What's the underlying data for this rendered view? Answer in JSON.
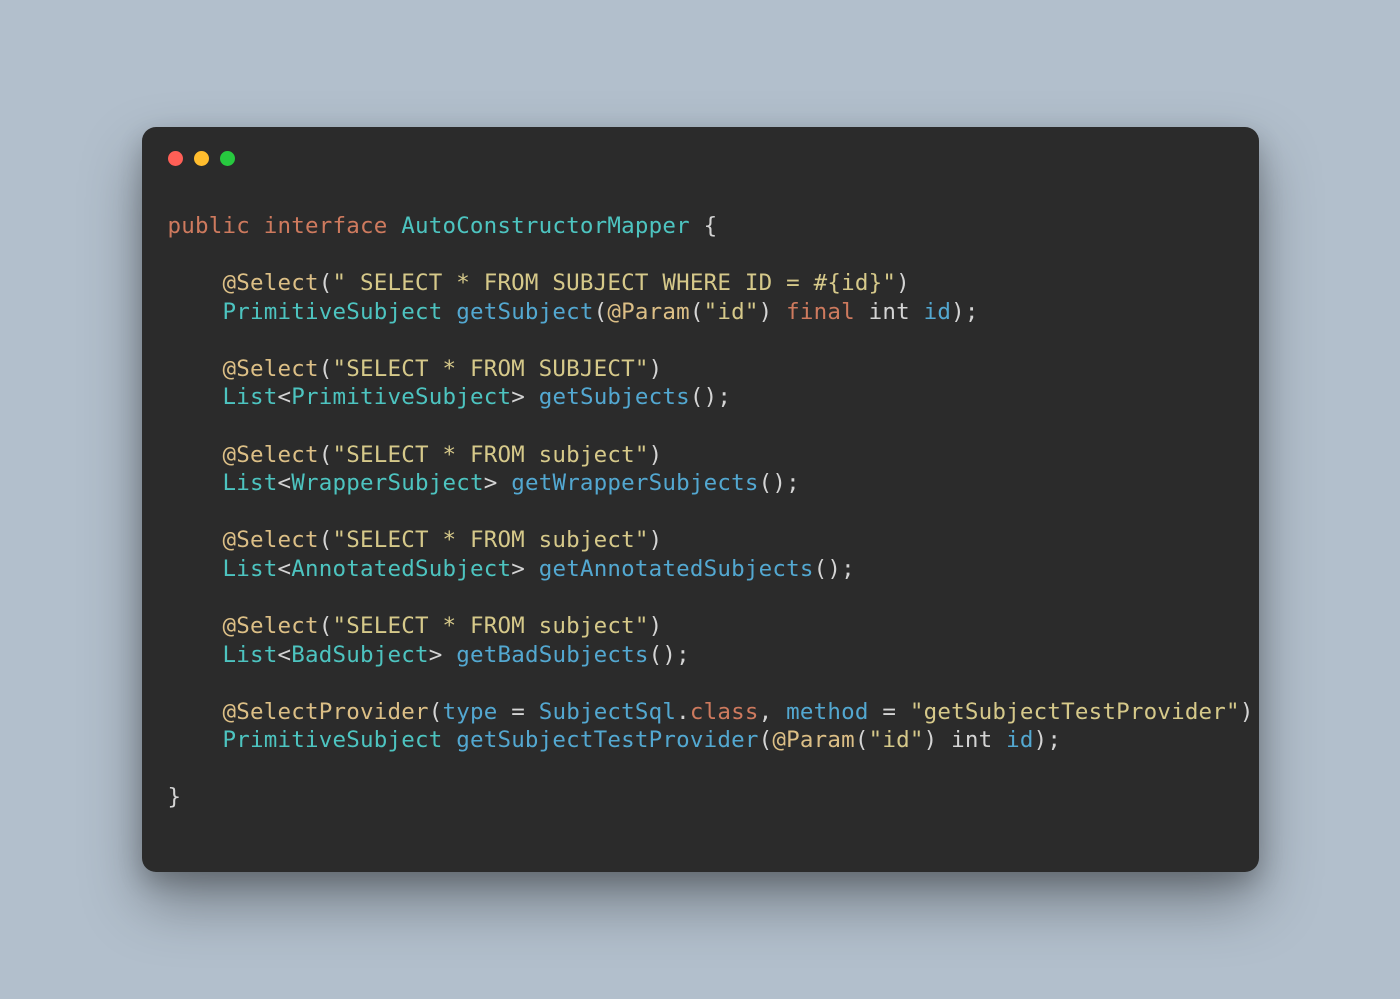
{
  "line1": {
    "kw1": "public",
    "kw2": "interface",
    "typename": "AutoConstructorMapper",
    "brace": " {"
  },
  "m1": {
    "ann": "@Select",
    "p_open": "(",
    "str": "\" SELECT * FROM SUBJECT WHERE ID = #{id}\"",
    "p_close": ")",
    "ret": "PrimitiveSubject",
    "name": "getSubject",
    "sig_open": "(",
    "param_ann": "@Param",
    "param_open": "(",
    "param_str": "\"id\"",
    "param_close": ")",
    "kw_final": "final",
    "ptype": "int",
    "pname": "id",
    "sig_close": ");"
  },
  "m2": {
    "ann": "@Select",
    "p_open": "(",
    "str": "\"SELECT * FROM SUBJECT\"",
    "p_close": ")",
    "ret1": "List",
    "lt": "<",
    "ret2": "PrimitiveSubject",
    "gt": ">",
    "name": "getSubjects",
    "sig": "();"
  },
  "m3": {
    "ann": "@Select",
    "p_open": "(",
    "str": "\"SELECT * FROM subject\"",
    "p_close": ")",
    "ret1": "List",
    "lt": "<",
    "ret2": "WrapperSubject",
    "gt": ">",
    "name": "getWrapperSubjects",
    "sig": "();"
  },
  "m4": {
    "ann": "@Select",
    "p_open": "(",
    "str": "\"SELECT * FROM subject\"",
    "p_close": ")",
    "ret1": "List",
    "lt": "<",
    "ret2": "AnnotatedSubject",
    "gt": ">",
    "name": "getAnnotatedSubjects",
    "sig": "();"
  },
  "m5": {
    "ann": "@Select",
    "p_open": "(",
    "str": "\"SELECT * FROM subject\"",
    "p_close": ")",
    "ret1": "List",
    "lt": "<",
    "ret2": "BadSubject",
    "gt": ">",
    "name": "getBadSubjects",
    "sig": "();"
  },
  "m6": {
    "ann": "@SelectProvider",
    "p_open": "(",
    "k_type": "type",
    "eq1": " = ",
    "cls": "SubjectSql",
    "dot": ".",
    "kw_class": "class",
    "comma": ", ",
    "k_method": "method",
    "eq2": " = ",
    "str": "\"getSubjectTestProvider\"",
    "p_close": ")",
    "ret": "PrimitiveSubject",
    "name": "getSubjectTestProvider",
    "sig_open": "(",
    "param_ann": "@Param",
    "param_open": "(",
    "param_str": "\"id\"",
    "param_close": ")",
    "ptype": "int",
    "pname": "id",
    "sig_close": ");"
  },
  "closeBrace": "}"
}
